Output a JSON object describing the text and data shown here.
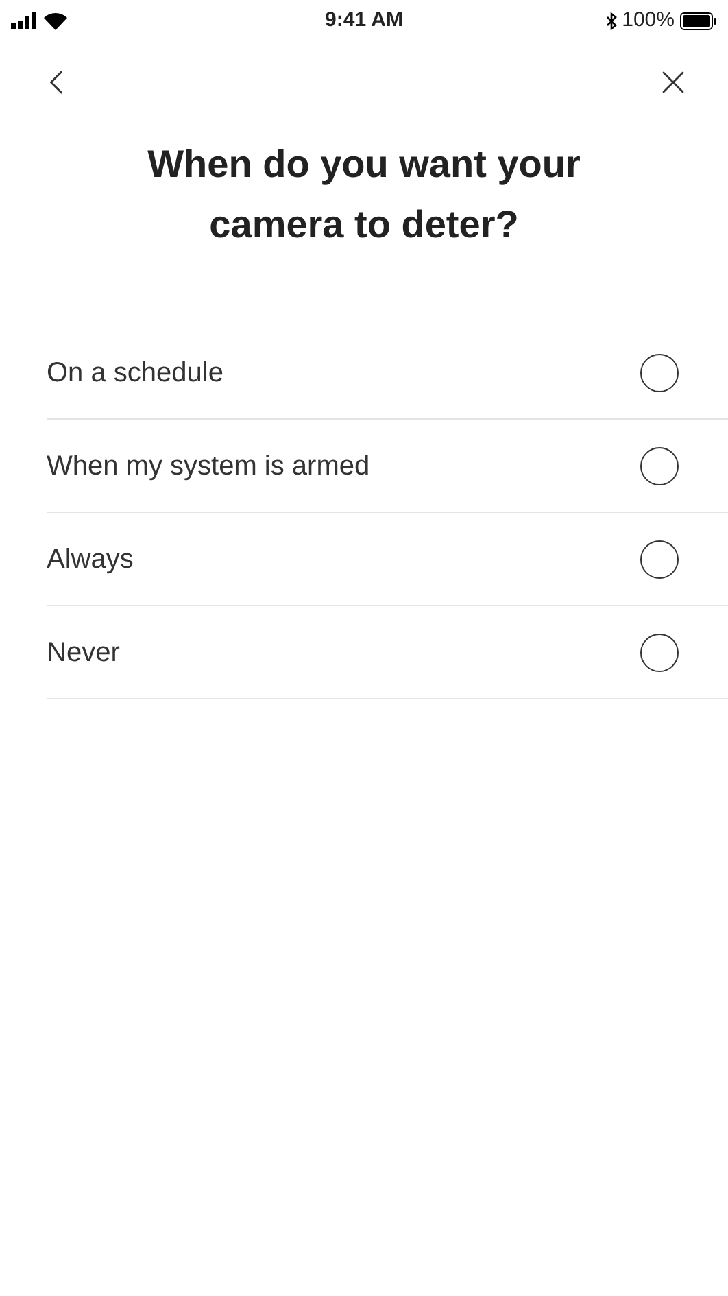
{
  "status_bar": {
    "time": "9:41 AM",
    "battery": "100%"
  },
  "title": "When do you want your camera to deter?",
  "options": [
    {
      "label": "On a schedule",
      "selected": false
    },
    {
      "label": "When my system is armed",
      "selected": false
    },
    {
      "label": "Always",
      "selected": false
    },
    {
      "label": "Never",
      "selected": false
    }
  ]
}
